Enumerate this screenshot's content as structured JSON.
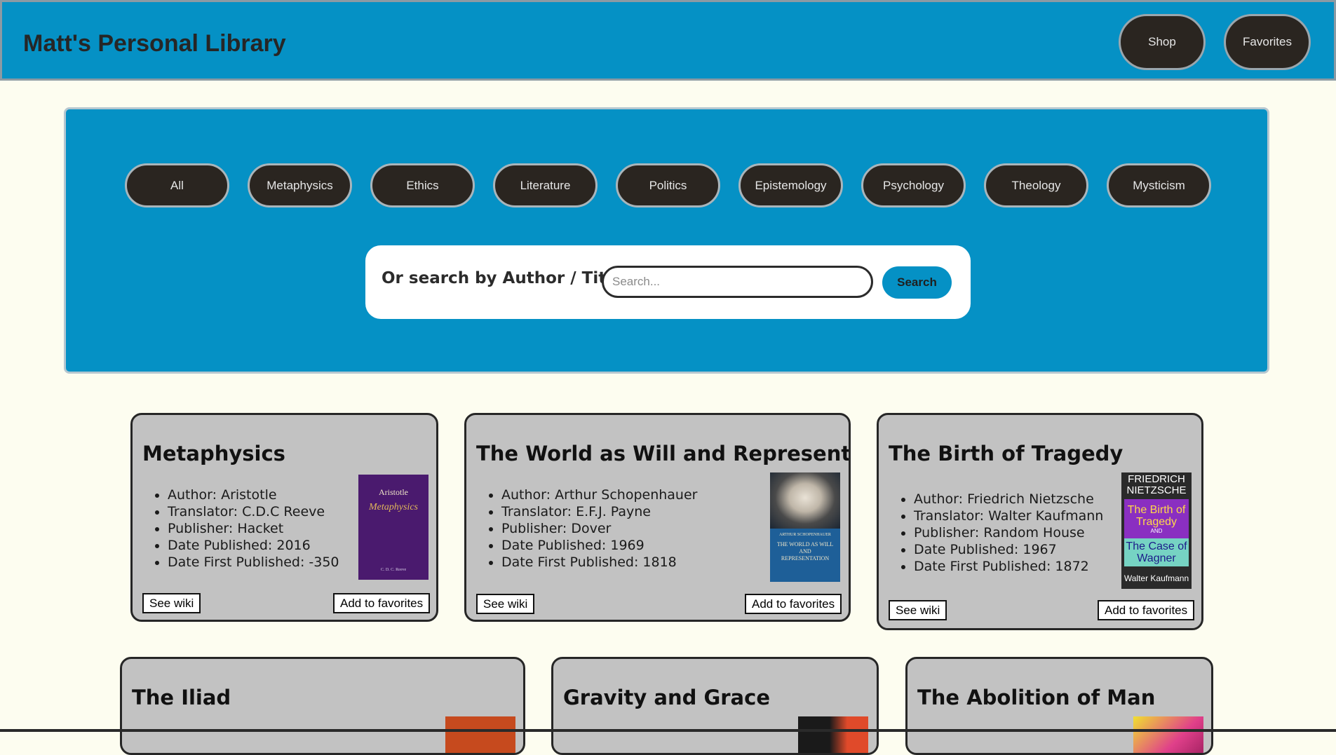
{
  "header": {
    "title": "Matt's Personal Library",
    "nav": [
      {
        "label": "Shop"
      },
      {
        "label": "Favorites"
      }
    ]
  },
  "filters": {
    "categories": [
      "All",
      "Metaphysics",
      "Ethics",
      "Literature",
      "Politics",
      "Epistemology",
      "Psychology",
      "Theology",
      "Mysticism"
    ],
    "search_label": "Or search by Author / Title:",
    "search_placeholder": "Search...",
    "search_value": "",
    "search_button": "Search"
  },
  "books": [
    {
      "title": "Metaphysics",
      "details": [
        "Author: Aristotle",
        "Translator: C.D.C Reeve",
        "Publisher: Hacket",
        "Date Published: 2016",
        "Date First Published: -350"
      ],
      "cover": {
        "color": "#4a1a6e",
        "line1": "Aristotle",
        "line2": "Metaphysics",
        "line3": "C. D. C. Reeve"
      },
      "wiki_label": "See wiki",
      "fav_label": "Add to favorites"
    },
    {
      "title": "The World as Will and Representation",
      "details": [
        "Author: Arthur Schopenhauer",
        "Translator: E.F.J. Payne",
        "Publisher: Dover",
        "Date Published: 1969",
        "Date First Published: 1818"
      ],
      "cover": {
        "color": "#1e5f98",
        "line1": "ARTHUR SCHOPENHAUER",
        "line2": "THE WORLD AS WILL AND REPRESENTATION"
      },
      "wiki_label": "See wiki",
      "fav_label": "Add to favorites"
    },
    {
      "title": "The Birth of Tragedy",
      "details": [
        "Author: Friedrich Nietzsche",
        "Translator: Walter Kaufmann",
        "Publisher: Random House",
        "Date Published: 1967",
        "Date First Published: 1872"
      ],
      "cover": {
        "color": "#2a2a2a",
        "line1": "FRIEDRICH NIETZSCHE",
        "line2": "The Birth of Tragedy",
        "line3": "AND",
        "line4": "The Case of Wagner",
        "line5": "Walter Kaufmann"
      },
      "wiki_label": "See wiki",
      "fav_label": "Add to favorites"
    },
    {
      "title": "The Iliad"
    },
    {
      "title": "Gravity and Grace"
    },
    {
      "title": "The Abolition of Man"
    }
  ],
  "colors": {
    "brand": "#0591c5",
    "page_bg": "#fdfdf0",
    "button_dark": "#2a2520",
    "card_bg": "#c2c2c2"
  }
}
